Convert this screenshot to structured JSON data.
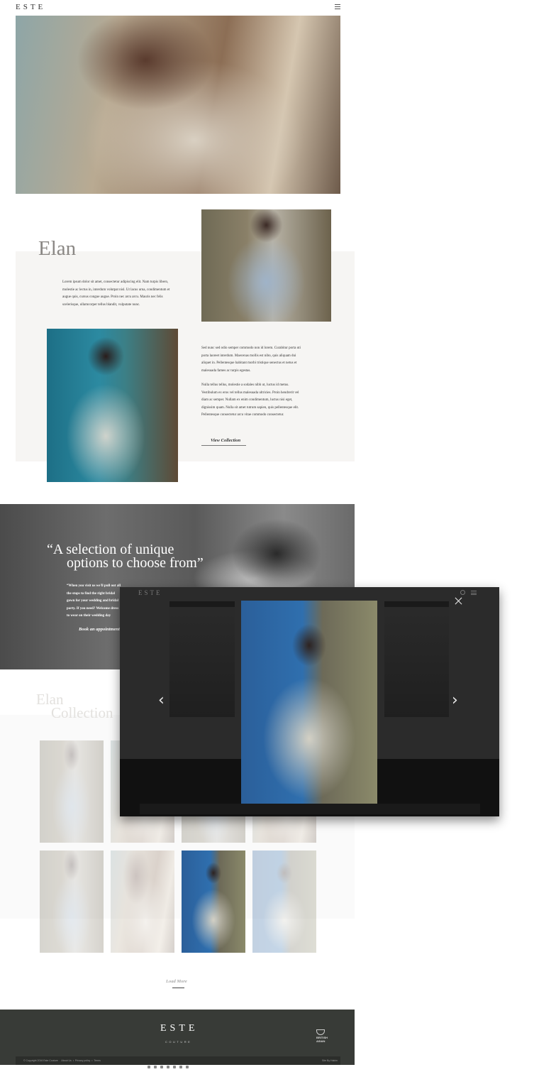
{
  "header": {
    "logo": "ESTE",
    "menu_icon": "hamburger-menu-icon"
  },
  "intro": {
    "heading": "Elan",
    "paragraph": "Lorem ipsum dolor sit amet, consectetur adipiscing elit. Nam turpis libero, molestie ac lectus in, interdum volutpat nisl. Ut lacus urna, condimentum et augue quis, cursus congue augue. Proin nec arcu arcu. Mauris nec felis scelerisque, ullamcorper tellus blandit, vulputate nunc.",
    "paragraph2": "Sed nunc sed odio semper commodo non id lorem. Curabitur porta uti porta laoreet interdum. Maecenas mollis est nibo, quis aliquam dui aliquet in. Pellentesque habitant morbi tristique senectus et netus et malesuada fames ac turpis egestas.",
    "paragraph3": "Nulla tellus tellus, molestie a sodales nibh ut, luctus id metus. Vestibulum ex eros vel tellus malesuada ultricies. Proin hendrerit vel diam ac semper. Nullam ex enim condimentum, luctus nisi eget, dignissim quam. Nulla sit amet rutrum sapien, quis pellentesque elit. Pellentesque consectetur arcu vitae commodo consectetur.",
    "view_collection": "View Collection"
  },
  "quote": {
    "line1": "“A selection of unique",
    "line2": "options to choose from”",
    "text": "“When you visit us we'll pull out all the stops to find the right bridal gown for your wedding and bridal party. If you need? Welcome dress to wear on their wedding day selection of unique options to choose",
    "book_link": "Book an appointment"
  },
  "collection": {
    "line1": "Elan",
    "line2": "Collection",
    "load_more": "Load More"
  },
  "lightbox": {
    "logo": "ESTE",
    "close_icon": "close-icon",
    "prev_icon": "chevron-left-icon",
    "next_icon": "chevron-right-icon"
  },
  "footer": {
    "logo": "ESTE",
    "tagline": "COUTURE",
    "award": "BRITISH ASIAN",
    "bottom_left": "© Copyright 2016 Este Couture     About Us  •  Privacy policy  •  Terms",
    "bottom_right": "Site By Hakim"
  },
  "colors": {
    "footer_bg": "#383b37",
    "pale_panel": "#f6f5f3",
    "lightbox_bg": "#2b2b2b"
  }
}
